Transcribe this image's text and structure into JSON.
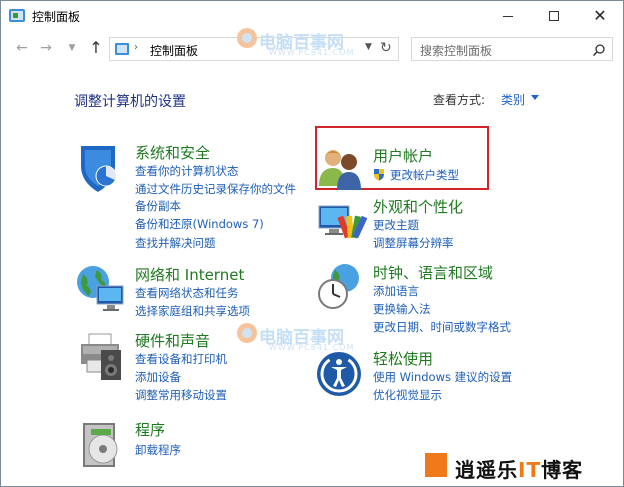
{
  "window": {
    "title": "控制面板"
  },
  "nav": {
    "address": "控制面板",
    "search_placeholder": "搜索控制面板"
  },
  "main": {
    "heading": "调整计算机的设置",
    "view_by_label": "查看方式:",
    "view_by_value": "类别"
  },
  "categories": [
    {
      "title": "系统和安全",
      "links": [
        "查看你的计算机状态",
        "通过文件历史记录保存你的文件",
        "备份副本",
        "备份和还原(Windows 7)",
        "查找并解决问题"
      ]
    },
    {
      "title": "网络和 Internet",
      "links": [
        "查看网络状态和任务",
        "选择家庭组和共享选项"
      ]
    },
    {
      "title": "硬件和声音",
      "links": [
        "查看设备和打印机",
        "添加设备",
        "调整常用移动设置"
      ]
    },
    {
      "title": "程序",
      "links": [
        "卸载程序"
      ]
    },
    {
      "title": "用户帐户",
      "links": [
        "更改帐户类型"
      ]
    },
    {
      "title": "外观和个性化",
      "links": [
        "更改主题",
        "调整屏幕分辨率"
      ]
    },
    {
      "title": "时钟、语言和区域",
      "links": [
        "添加语言",
        "更换输入法",
        "更改日期、时间或数字格式"
      ]
    },
    {
      "title": "轻松使用",
      "links": [
        "使用 Windows 建议的设置",
        "优化视觉显示"
      ]
    }
  ],
  "watermark": {
    "text": "电脑百事网",
    "sub": "WWW.PC841.COM"
  },
  "brand": {
    "text_a": "逍遥乐",
    "text_it": "IT",
    "text_b": "博客"
  },
  "colors": {
    "category_title": "#1f7a1f",
    "link": "#1e5fb8",
    "heading": "#1e3287",
    "highlight": "#d0262a"
  }
}
